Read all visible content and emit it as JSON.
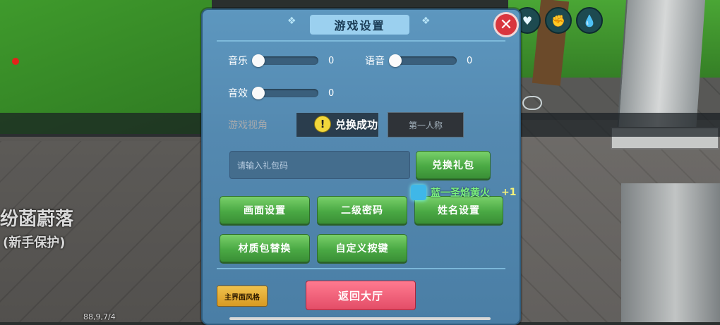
{
  "panel": {
    "title": "游戏设置",
    "close_symbol": "✕",
    "sliders": [
      {
        "label": "音乐",
        "value": "0"
      },
      {
        "label": "语音",
        "value": "0"
      },
      {
        "label": "音效",
        "value": "0"
      }
    ],
    "view": {
      "label": "游戏视角",
      "first_person": "第一人称"
    },
    "toast": "兑换成功",
    "gift": {
      "placeholder": "请输入礼包码",
      "redeem_label": "兑换礼包"
    },
    "buttons": [
      "画面设置",
      "二级密码",
      "姓名设置",
      "材质包替换",
      "自定义按键"
    ],
    "style_button": "主界面风格",
    "lobby_button": "返回大厅"
  },
  "loot": {
    "text": "蓝一圣焰黄火",
    "plus": "+1"
  },
  "world": {
    "area_name": "纷菡蔚落",
    "area_status": "(新手保护)",
    "coords": "88,9,7/4"
  },
  "colors": {
    "panel_bg": "#5489b0",
    "green_button": "#4aa944",
    "lobby_button": "#e34d67",
    "style_button": "#d89a22",
    "close": "#d9363e"
  },
  "icons": [
    "heart-icon",
    "arm-icon",
    "water-drop-icon",
    "eye-icon",
    "warning-icon",
    "close-icon"
  ]
}
